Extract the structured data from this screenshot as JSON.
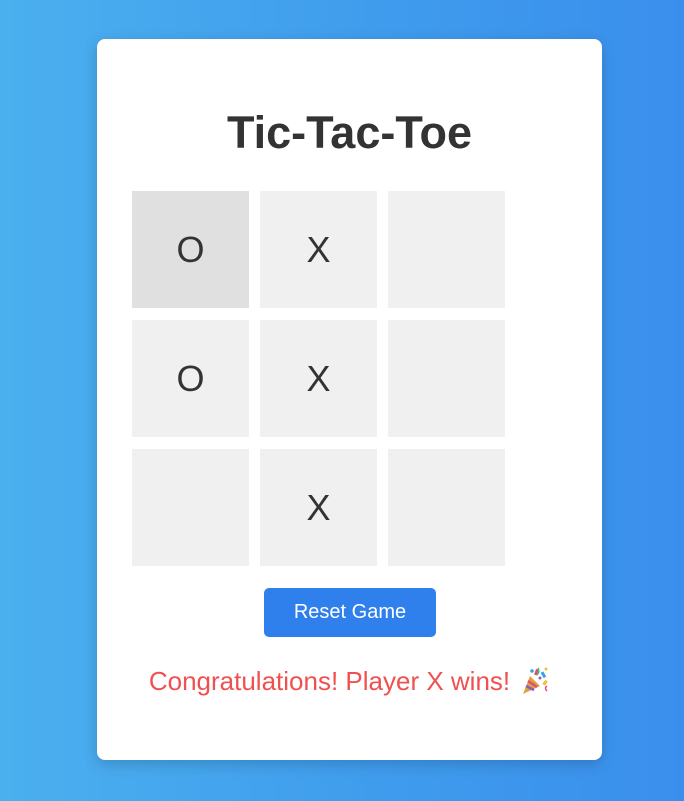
{
  "game": {
    "title": "Tic-Tac-Toe",
    "board": [
      "O",
      "X",
      "",
      "O",
      "X",
      "",
      "",
      "X",
      ""
    ],
    "reset_label": "Reset Game",
    "status_message": "Congratulations! Player X wins!",
    "status_icon": "party-popper-icon"
  },
  "colors": {
    "background_gradient_start": "#4bb0ee",
    "background_gradient_end": "#3a8fec",
    "button": "#2f80ed",
    "status_text": "#f05050",
    "cell": "#f0f0f0",
    "cell_hover": "#e0e0e0"
  }
}
